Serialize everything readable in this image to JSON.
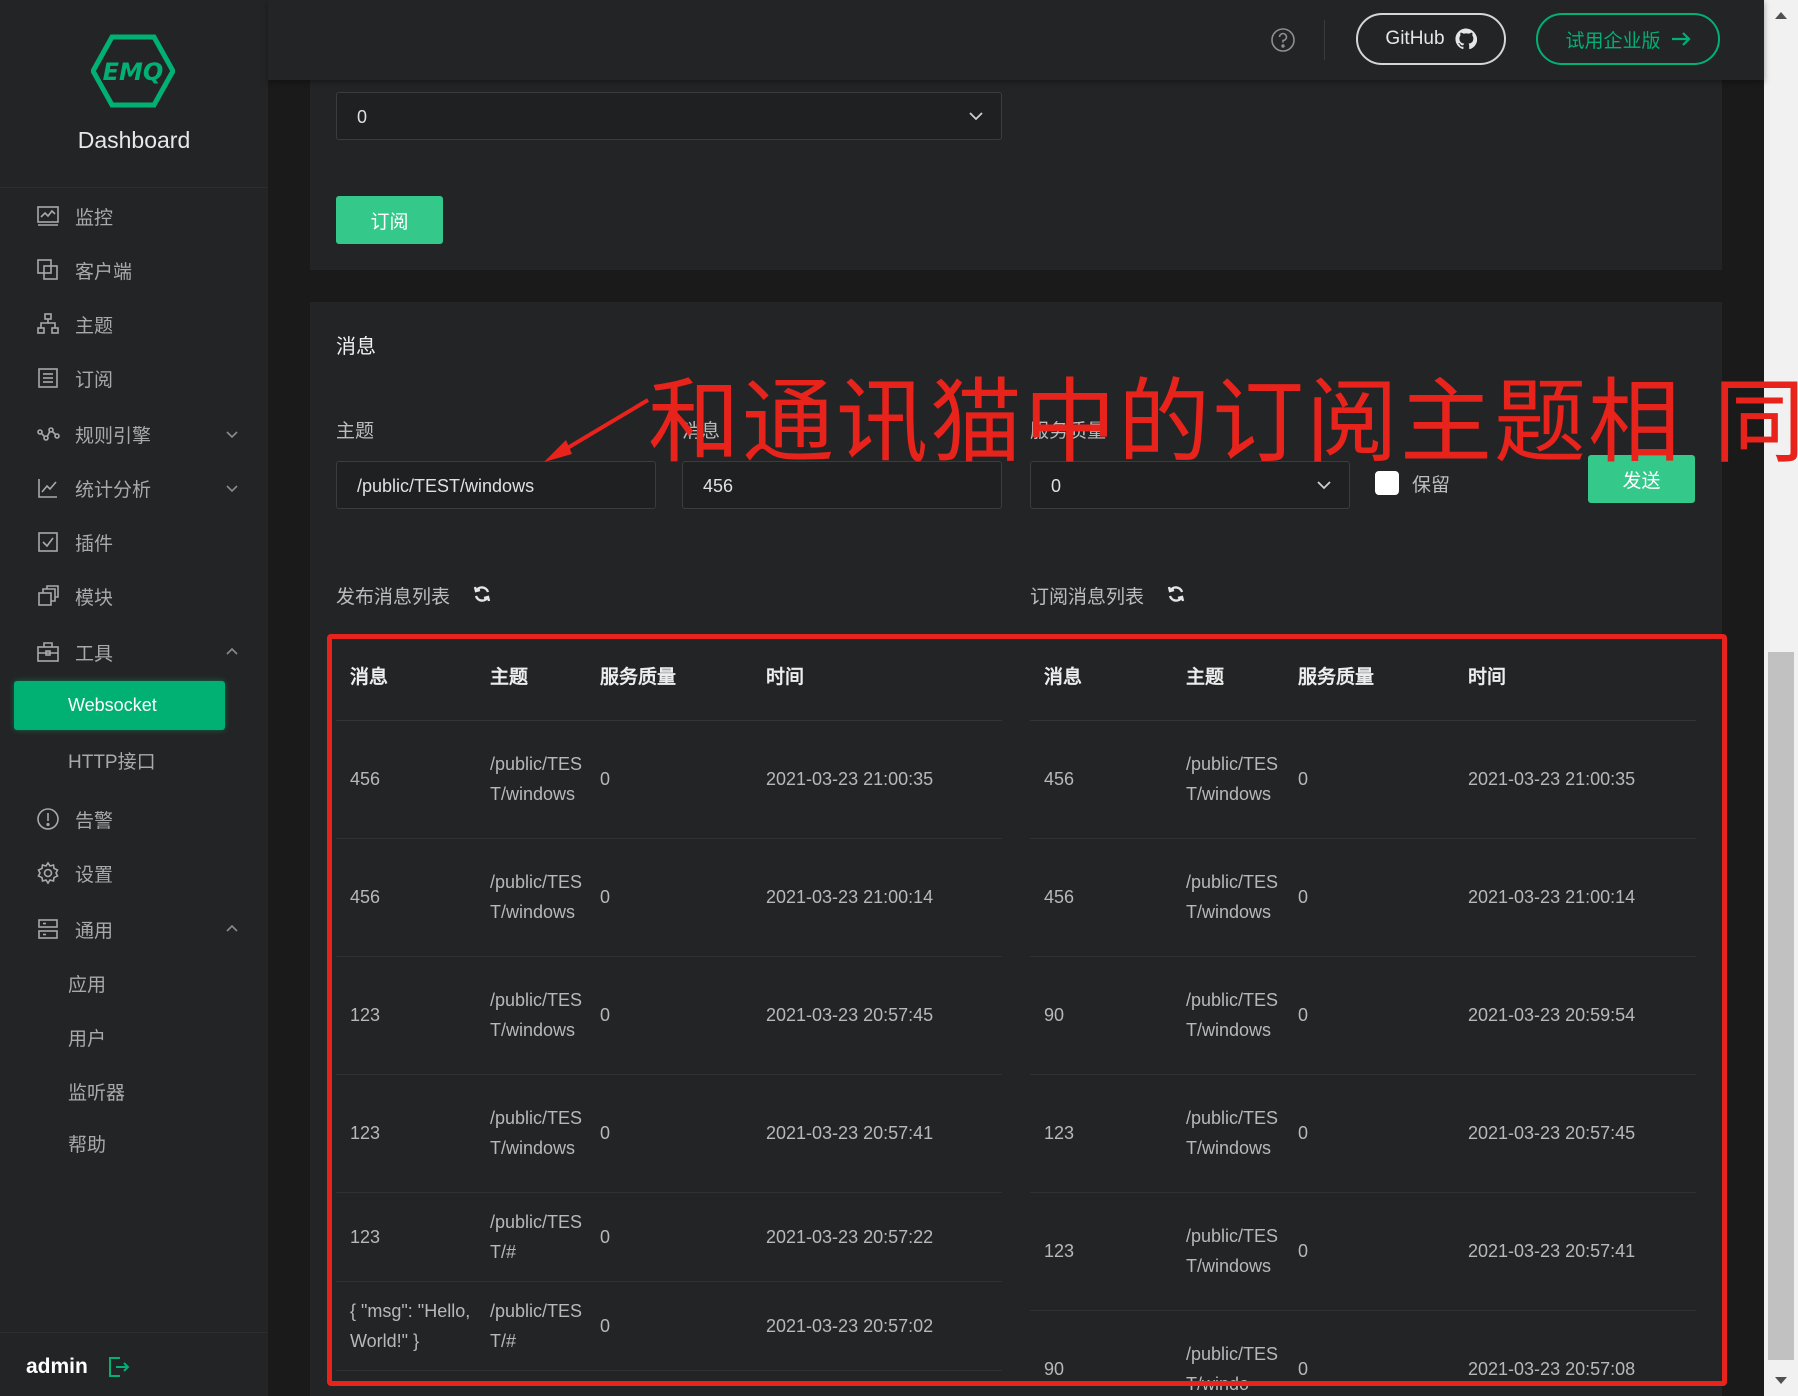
{
  "brand": {
    "logo_text": "EMQ",
    "title": "Dashboard"
  },
  "sidebar": {
    "items": [
      {
        "label": "监控",
        "icon": "monitor-icon"
      },
      {
        "label": "客户端",
        "icon": "clients-icon"
      },
      {
        "label": "主题",
        "icon": "topics-icon"
      },
      {
        "label": "订阅",
        "icon": "subscriptions-icon"
      },
      {
        "label": "规则引擎",
        "icon": "rule-engine-icon"
      },
      {
        "label": "统计分析",
        "icon": "analytics-icon"
      },
      {
        "label": "插件",
        "icon": "plugins-icon"
      },
      {
        "label": "模块",
        "icon": "modules-icon"
      },
      {
        "label": "工具",
        "icon": "tools-icon"
      },
      {
        "label": "Websocket"
      },
      {
        "label": "HTTP接口"
      },
      {
        "label": "告警",
        "icon": "alarm-icon"
      },
      {
        "label": "设置",
        "icon": "settings-icon"
      },
      {
        "label": "通用",
        "icon": "general-icon"
      },
      {
        "label": "应用"
      },
      {
        "label": "用户"
      },
      {
        "label": "监听器"
      },
      {
        "label": "帮助"
      }
    ],
    "user": "admin"
  },
  "header": {
    "github_label": "GitHub",
    "enterprise_label": "试用企业版"
  },
  "subscribe": {
    "qos_value": "0",
    "button_label": "订阅"
  },
  "message": {
    "section_title": "消息",
    "topic_label": "主题",
    "topic_value": "/public/TEST/windows",
    "payload_label": "消息",
    "payload_value": "456",
    "qos_label": "服务质量",
    "qos_value": "0",
    "retain_label": "保留",
    "send_label": "发送"
  },
  "published": {
    "title": "发布消息列表",
    "columns": [
      "消息",
      "主题",
      "服务质量",
      "时间"
    ],
    "rows": [
      [
        "456",
        "/public/TEST/windows",
        "0",
        "2021-03-23 21:00:35"
      ],
      [
        "456",
        "/public/TEST/windows",
        "0",
        "2021-03-23 21:00:14"
      ],
      [
        "123",
        "/public/TEST/windows",
        "0",
        "2021-03-23 20:57:45"
      ],
      [
        "123",
        "/public/TEST/windows",
        "0",
        "2021-03-23 20:57:41"
      ],
      [
        "123",
        "/public/TEST/#",
        "0",
        "2021-03-23 20:57:22"
      ],
      [
        "{ \"msg\": \"Hello, World!\" }",
        "/public/TEST/#",
        "0",
        "2021-03-23 20:57:02"
      ]
    ]
  },
  "received": {
    "title": "订阅消息列表",
    "columns": [
      "消息",
      "主题",
      "服务质量",
      "时间"
    ],
    "rows": [
      [
        "456",
        "/public/TEST/windows",
        "0",
        "2021-03-23 21:00:35"
      ],
      [
        "456",
        "/public/TEST/windows",
        "0",
        "2021-03-23 21:00:14"
      ],
      [
        "90",
        "/public/TEST/windows",
        "0",
        "2021-03-23 20:59:54"
      ],
      [
        "123",
        "/public/TEST/windows",
        "0",
        "2021-03-23 20:57:45"
      ],
      [
        "123",
        "/public/TEST/windows",
        "0",
        "2021-03-23 20:57:41"
      ],
      [
        "90",
        "/public/TEST/windo",
        "0",
        "2021-03-23 20:57:08"
      ]
    ]
  },
  "annotation": {
    "text": "和通讯猫中的订阅主题相 同"
  },
  "colors": {
    "accent": "#00b173",
    "button": "#34c88a",
    "annotation": "#e8231c",
    "sidebar_bg": "#232426"
  }
}
